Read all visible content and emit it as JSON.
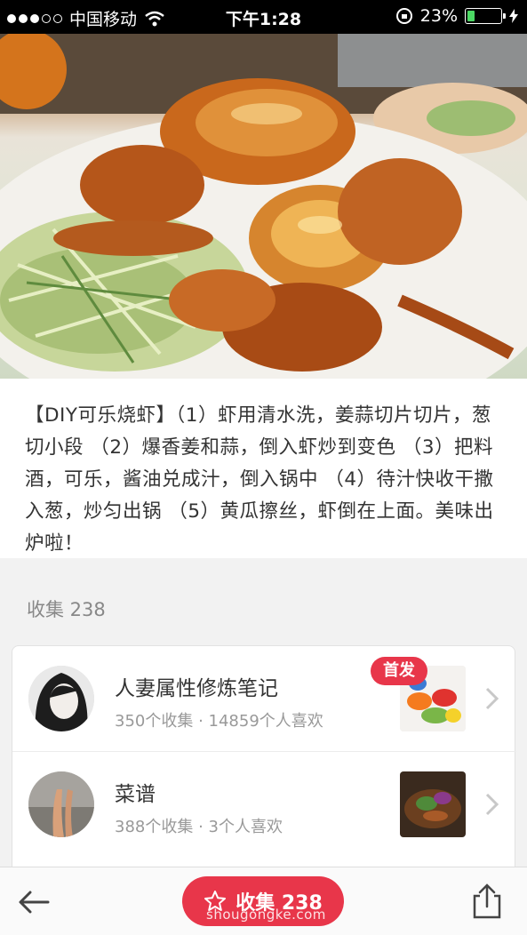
{
  "status_bar": {
    "carrier": "中国移动",
    "time": "下午1:28",
    "battery_percent": "23%",
    "battery_level": 0.23,
    "icons": [
      "signal-dots-icon",
      "wifi-icon",
      "orientation-lock-icon",
      "battery-icon",
      "charging-bolt-icon"
    ]
  },
  "recipe": {
    "description": "【DIY可乐烧虾】（1）虾用清水洗，姜蒜切片切片，葱切小段 （2）爆香姜和蒜，倒入虾炒到变色 （3）把料酒，可乐，酱油兑成汁，倒入锅中 （4）待汁快收干撒入葱，炒匀出锅 （5）黄瓜擦丝，虾倒在上面。美味出炉啦！"
  },
  "collections": {
    "title": "收集 238",
    "items": [
      {
        "title": "人妻属性修炼笔记",
        "subtitle": "350个收集 · 14859个人喜欢",
        "badge": "首发"
      },
      {
        "title": "菜谱",
        "subtitle": "388个收集 · 3个人喜欢"
      }
    ]
  },
  "bottom_bar": {
    "favorite_label": "收集 238",
    "watermark": "shougongke.com",
    "icons": [
      "back-arrow-icon",
      "star-icon",
      "share-icon"
    ]
  },
  "colors": {
    "accent": "#e8364a",
    "battery": "#4cd964"
  }
}
